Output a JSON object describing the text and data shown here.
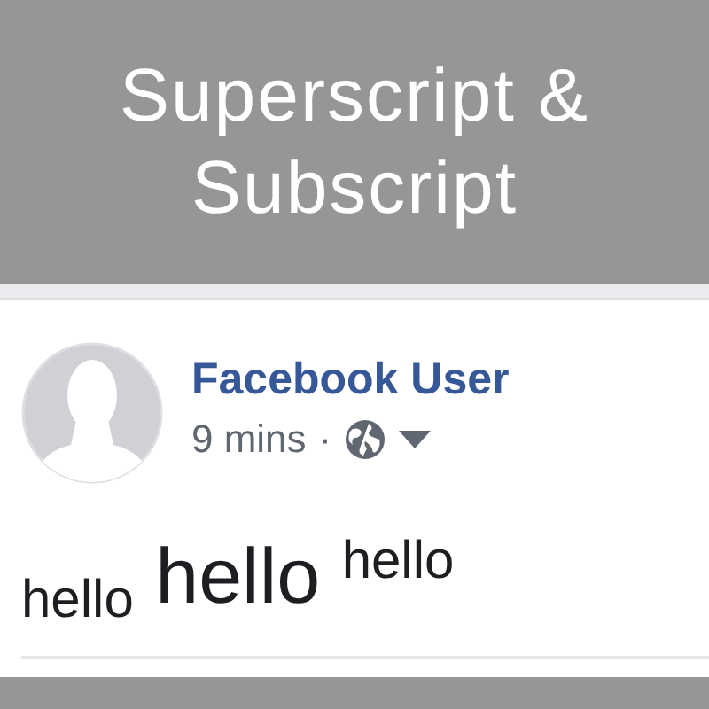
{
  "banner": {
    "title": "Superscript & Subscript"
  },
  "post": {
    "author": "Facebook User",
    "time": "9 mins",
    "separator": "·",
    "text": "$_{hello}$ hello $^{hello}$"
  }
}
